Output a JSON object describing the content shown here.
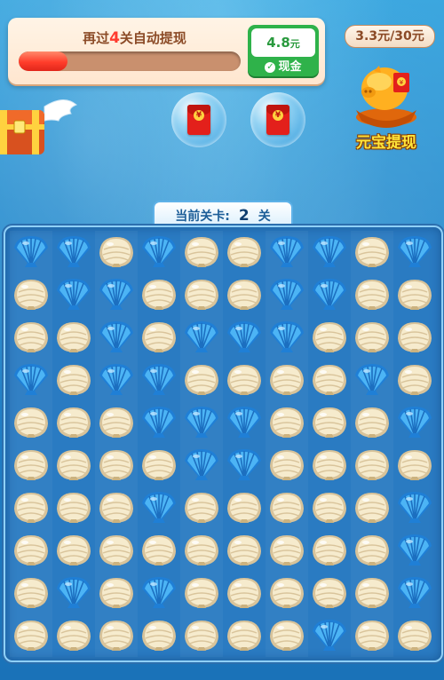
{
  "progress": {
    "prefix": "再过",
    "levels": "4",
    "suffix": "关自动提现",
    "fill_fraction": 0.22
  },
  "cash_card": {
    "amount": "4.8",
    "unit": "元",
    "label": "现金"
  },
  "money_pill": "3.3元/30元",
  "ingot_label": "元宝提现",
  "level": {
    "label": "当前关卡:",
    "number": "2",
    "unit": "关"
  },
  "colors": {
    "blue_shell": "#3fa2ee",
    "cream_shell": "#f3e6c4",
    "red_envelope": "#e3201b",
    "cash_green": "#2fb24a"
  },
  "board": {
    "rows": [
      [
        "blue",
        "blue",
        "cream",
        "blue",
        "cream",
        "cream",
        "blue",
        "blue",
        "cream",
        "blue"
      ],
      [
        "cream",
        "blue",
        "blue",
        "cream",
        "cream",
        "cream",
        "blue",
        "blue",
        "cream",
        "cream"
      ],
      [
        "cream",
        "cream",
        "blue",
        "cream",
        "blue",
        "blue",
        "blue",
        "cream",
        "cream",
        "cream"
      ],
      [
        "blue",
        "cream",
        "blue",
        "blue",
        "cream",
        "cream",
        "cream",
        "cream",
        "blue",
        "cream"
      ],
      [
        "cream",
        "cream",
        "cream",
        "blue",
        "blue",
        "blue",
        "cream",
        "cream",
        "cream",
        "blue"
      ],
      [
        "cream",
        "cream",
        "cream",
        "cream",
        "blue",
        "blue",
        "cream",
        "cream",
        "cream",
        "cream"
      ],
      [
        "cream",
        "cream",
        "cream",
        "blue",
        "cream",
        "cream",
        "cream",
        "cream",
        "cream",
        "blue"
      ],
      [
        "cream",
        "cream",
        "cream",
        "cream",
        "cream",
        "cream",
        "cream",
        "cream",
        "cream",
        "blue"
      ],
      [
        "cream",
        "blue",
        "cream",
        "blue",
        "cream",
        "cream",
        "cream",
        "cream",
        "cream",
        "blue"
      ],
      [
        "cream",
        "cream",
        "cream",
        "cream",
        "cream",
        "cream",
        "cream",
        "blue",
        "cream",
        "cream"
      ]
    ]
  }
}
